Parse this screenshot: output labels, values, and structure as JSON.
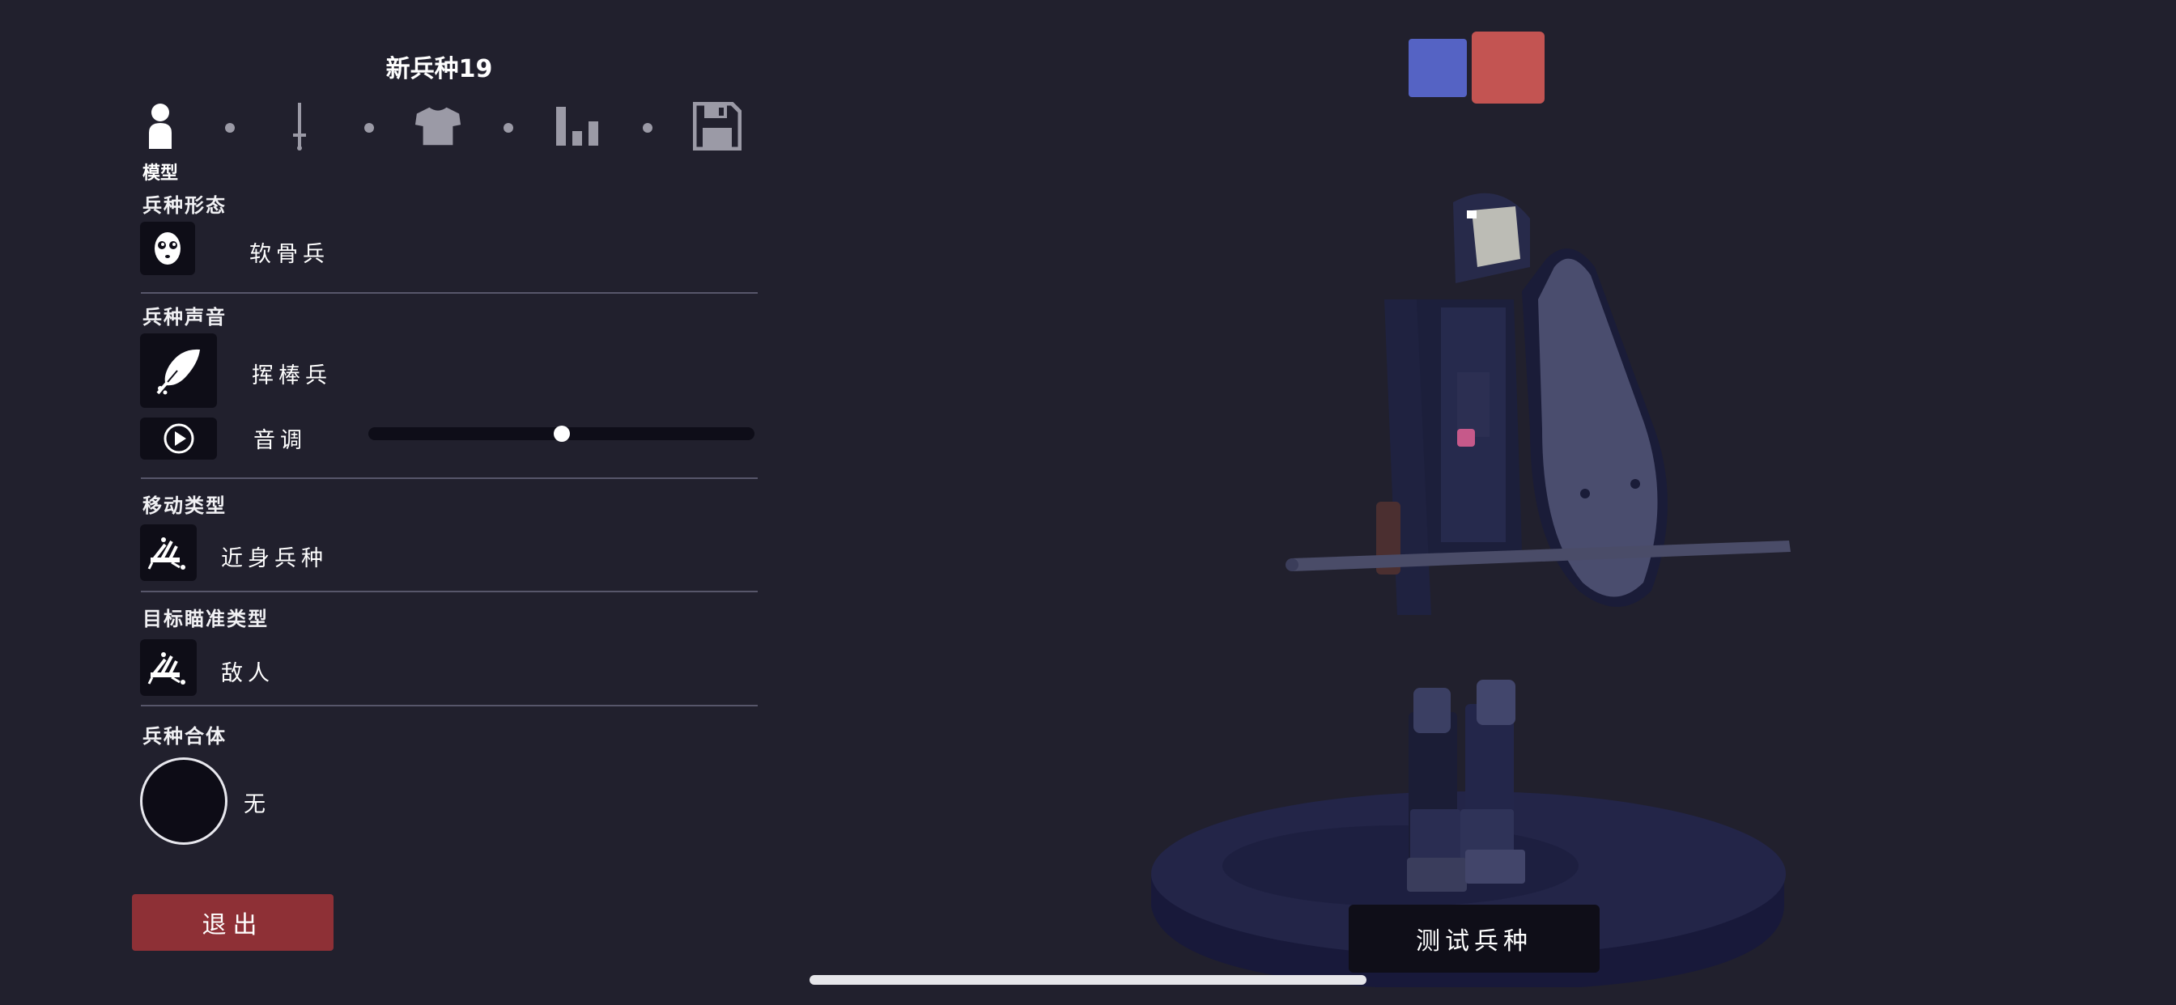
{
  "header": {
    "title": "新兵种19"
  },
  "tabs": [
    {
      "id": "model",
      "icon": "person-icon",
      "label": "模型",
      "active": true
    },
    {
      "id": "weapon",
      "icon": "sword-icon",
      "active": false
    },
    {
      "id": "clothing",
      "icon": "shirt-icon",
      "active": false
    },
    {
      "id": "stats",
      "icon": "bar-chart-icon",
      "active": false
    },
    {
      "id": "save",
      "icon": "floppy-disk-icon",
      "active": false
    }
  ],
  "sections": {
    "form": {
      "label": "兵种形态",
      "icon": "skull-face-icon",
      "value": "软骨兵"
    },
    "voice": {
      "label": "兵种声音",
      "icon": "feather-icon",
      "value": "挥棒兵",
      "pitch_label": "音调",
      "pitch_icon": "play-icon",
      "pitch_value": 0.5
    },
    "movement": {
      "label": "移动类型",
      "icon": "unit-group-icon",
      "value": "近身兵种"
    },
    "targeting": {
      "label": "目标瞄准类型",
      "icon": "unit-group-icon",
      "value": "敌人"
    },
    "merge": {
      "label": "兵种合体",
      "value": "无"
    }
  },
  "buttons": {
    "exit": "退出",
    "test": "测试兵种"
  },
  "teams": {
    "blue": "#5563c4",
    "red": "#c35452"
  },
  "colors": {
    "background": "#21202d",
    "exit_button": "#8e3036",
    "accent_white": "#ffffff"
  }
}
